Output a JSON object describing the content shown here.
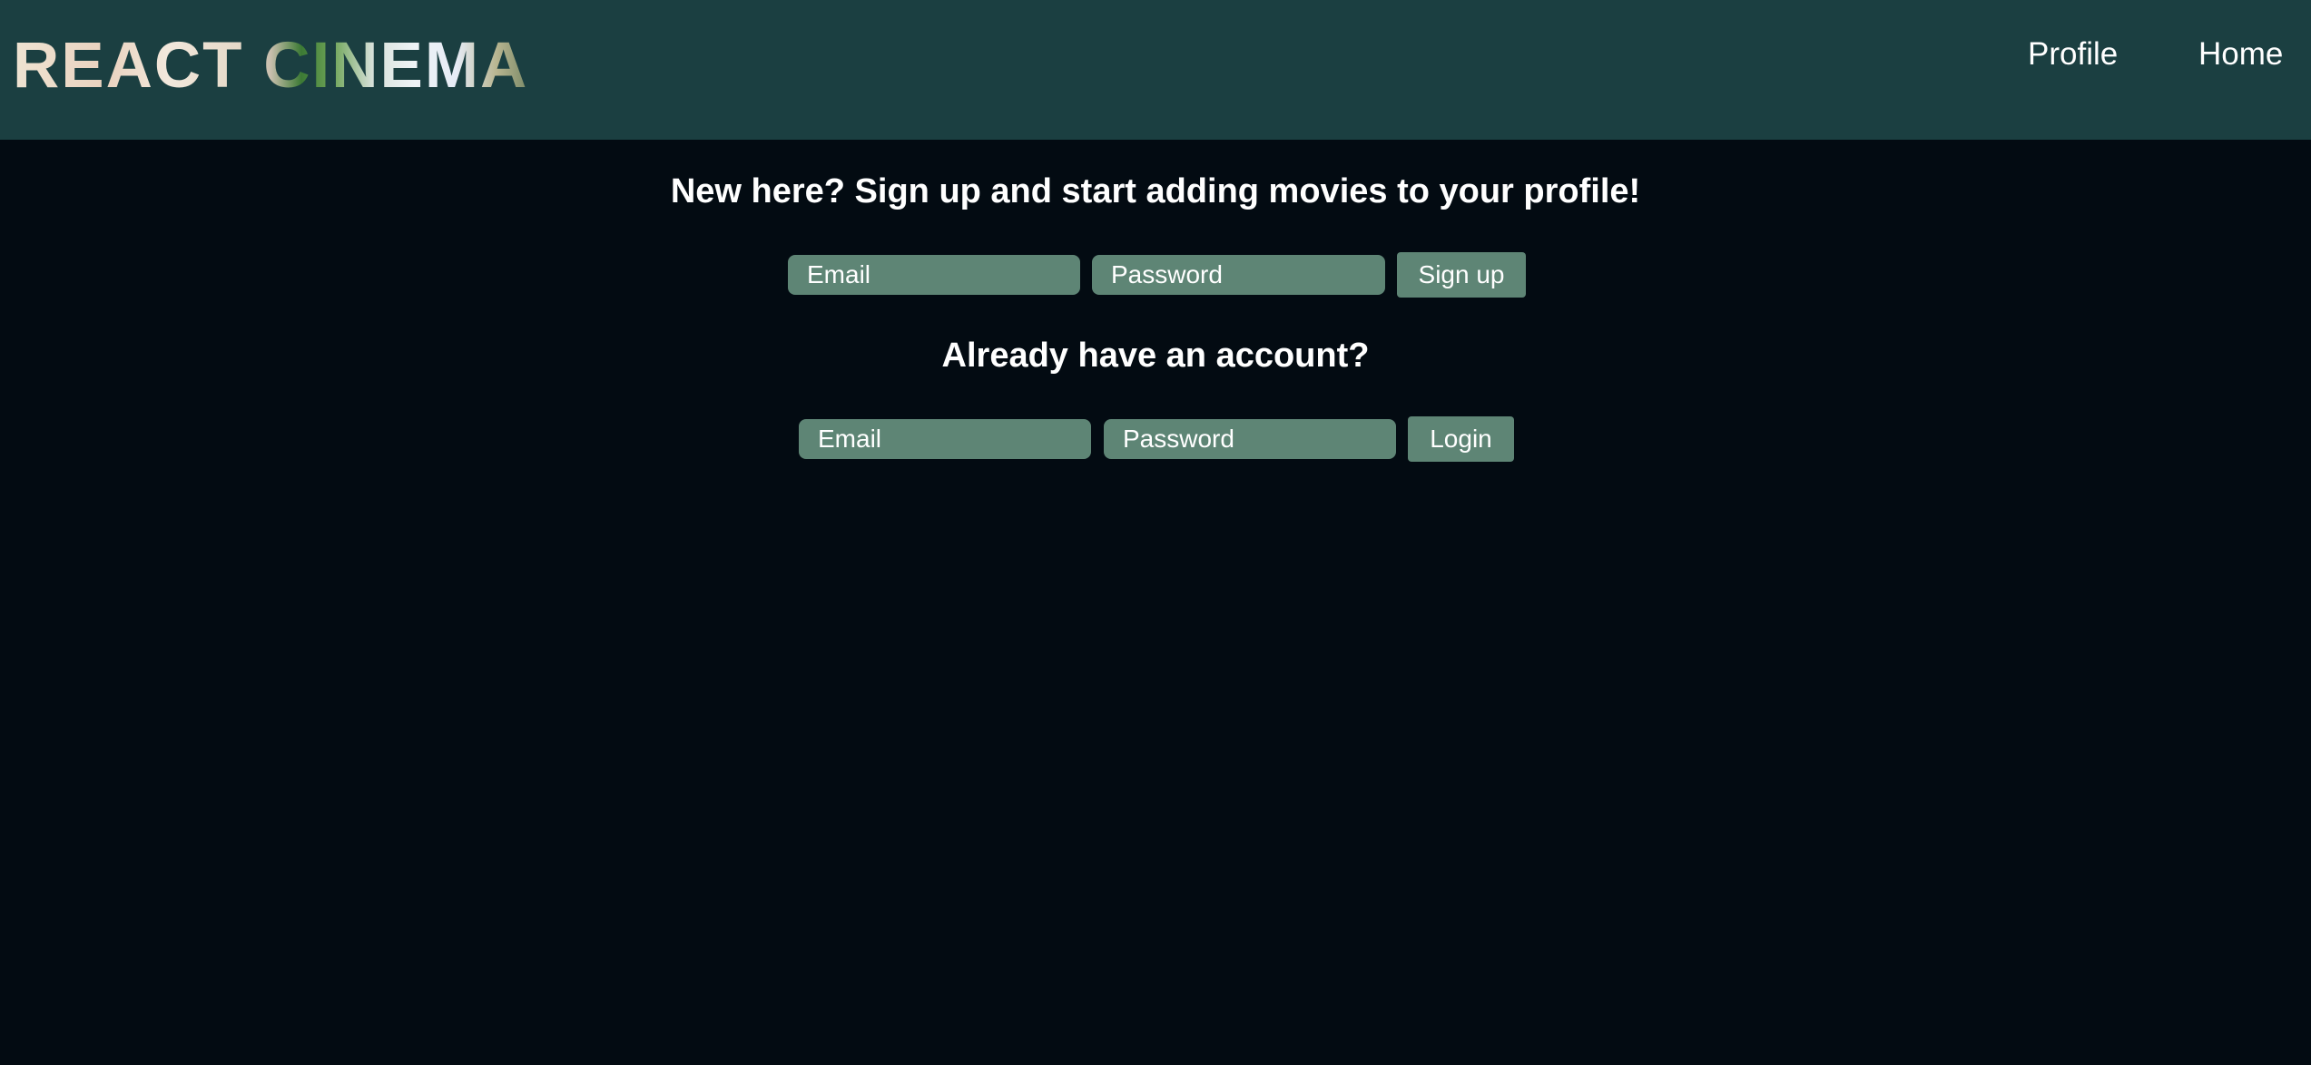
{
  "header": {
    "logo_text": "REACT CINEMA",
    "nav": {
      "profile": "Profile",
      "home": "Home"
    }
  },
  "signup": {
    "heading": "New here? Sign up and start adding movies to your profile!",
    "email_placeholder": "Email",
    "password_placeholder": "Password",
    "button_label": "Sign up"
  },
  "login": {
    "heading": "Already have an account?",
    "email_placeholder": "Email",
    "password_placeholder": "Password",
    "button_label": "Login"
  },
  "colors": {
    "header_bg": "#1b3f41",
    "page_bg": "#030b12",
    "control_bg": "#5e8575",
    "text": "#ffffff"
  }
}
